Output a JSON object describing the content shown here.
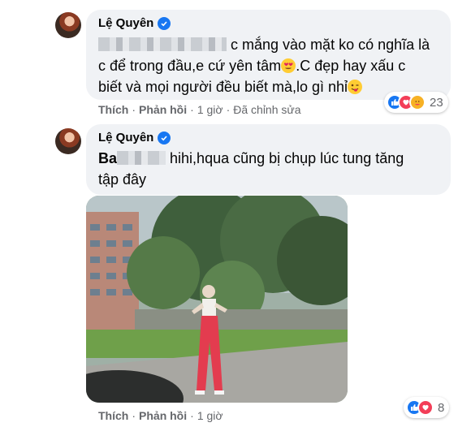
{
  "comments": [
    {
      "author": "Lệ Quyên",
      "text_lines": [
        "c mắng vào mặt ko có nghĩa là",
        "c để trong đầu,e cứ yên tâm",
        ".C đẹp hay xấu c",
        "biết và mọi người đều biết mà,lo gì nhỉ"
      ],
      "actions": {
        "like": "Thích",
        "reply": "Phản hồi",
        "time": "1 giờ",
        "edited": "Đã chỉnh sửa"
      },
      "reaction_count": "23",
      "reactions": [
        "like-icon",
        "love-icon",
        "care-icon"
      ]
    },
    {
      "author": "Lệ Quyên",
      "tag_partial": "Ba",
      "text_lines": [
        "hihi,hqua cũng bị chụp lúc tung tăng",
        "tập đây"
      ],
      "actions": {
        "like": "Thích",
        "reply": "Phản hồi",
        "time": "1 giờ"
      },
      "reaction_count": "8",
      "reactions": [
        "like-icon",
        "love-icon"
      ]
    }
  ],
  "colors": {
    "bubble": "#f0f2f5",
    "verified": "#1877f2",
    "meta_text": "#65676b",
    "like": "#1877f2",
    "love": "#f33e58",
    "care": "#f7b125"
  }
}
